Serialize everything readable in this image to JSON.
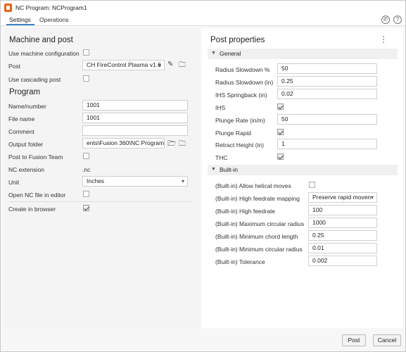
{
  "window": {
    "title": "NC Program: NCProgram1"
  },
  "tabs": [
    {
      "label": "Settings"
    },
    {
      "label": "Operations"
    }
  ],
  "top_icons": {
    "help_symbol": "?"
  },
  "left": {
    "machine_and_post": {
      "title": "Machine and post",
      "use_machine_configuration_label": "Use machine configuration",
      "post_label": "Post",
      "post_value": "CH FireControl Plasma v1.6",
      "use_cascading_post_label": "Use cascading post"
    },
    "program": {
      "title": "Program",
      "name_label": "Name/number",
      "name_value": "1001",
      "file_name_label": "File name",
      "file_name_value": "1001",
      "comment_label": "Comment",
      "comment_value": "",
      "output_folder_label": "Output folder",
      "output_folder_value": "ents\\Fusion 360\\NC Programs",
      "post_to_team_label": "Post to Fusion Team",
      "nc_extension_label": "NC extension",
      "nc_extension_value": ".nc",
      "unit_label": "Unit",
      "unit_value": "Inches",
      "open_nc_label": "Open NC file in editor",
      "create_in_browser_label": "Create in browser"
    }
  },
  "right": {
    "title": "Post properties",
    "general": {
      "label": "General",
      "radius_slowdown_pct_label": "Radius Slowdown %",
      "radius_slowdown_pct_value": "50",
      "radius_slowdown_in_label": "Radius Slowdown (in)",
      "radius_slowdown_in_value": "0.25",
      "ihs_springback_label": "IHS Springback (in)",
      "ihs_springback_value": "0.02",
      "ihs_label": "IHS",
      "plunge_rate_label": "Plunge Rate (in/m)",
      "plunge_rate_value": "50",
      "plunge_rapid_label": "Plunge Rapid",
      "retract_height_label": "Retract Height (in)",
      "retract_height_value": "1",
      "thc_label": "THC"
    },
    "builtin": {
      "label": "Built-in",
      "allow_helical_label": "(Built-in) Allow helical moves",
      "high_feedrate_mapping_label": "(Built-in) High feedrate mapping",
      "high_feedrate_mapping_value": "Preserve rapid moven",
      "high_feedrate_label": "(Built-in) High feedrate",
      "high_feedrate_value": "100",
      "max_circular_radius_label": "(Built-in) Maximum circular radius",
      "max_circular_radius_value": "1000",
      "min_chord_length_label": "(Built-in) Minimum chord length",
      "min_chord_length_value": "0.25",
      "min_circular_radius_label": "(Built-in) Minimum circular radius",
      "min_circular_radius_value": "0.01",
      "tolerance_label": "(Built-in) Tolerance",
      "tolerance_value": "0.002"
    }
  },
  "footer": {
    "post_button": "Post",
    "cancel_button": "Cancel"
  }
}
